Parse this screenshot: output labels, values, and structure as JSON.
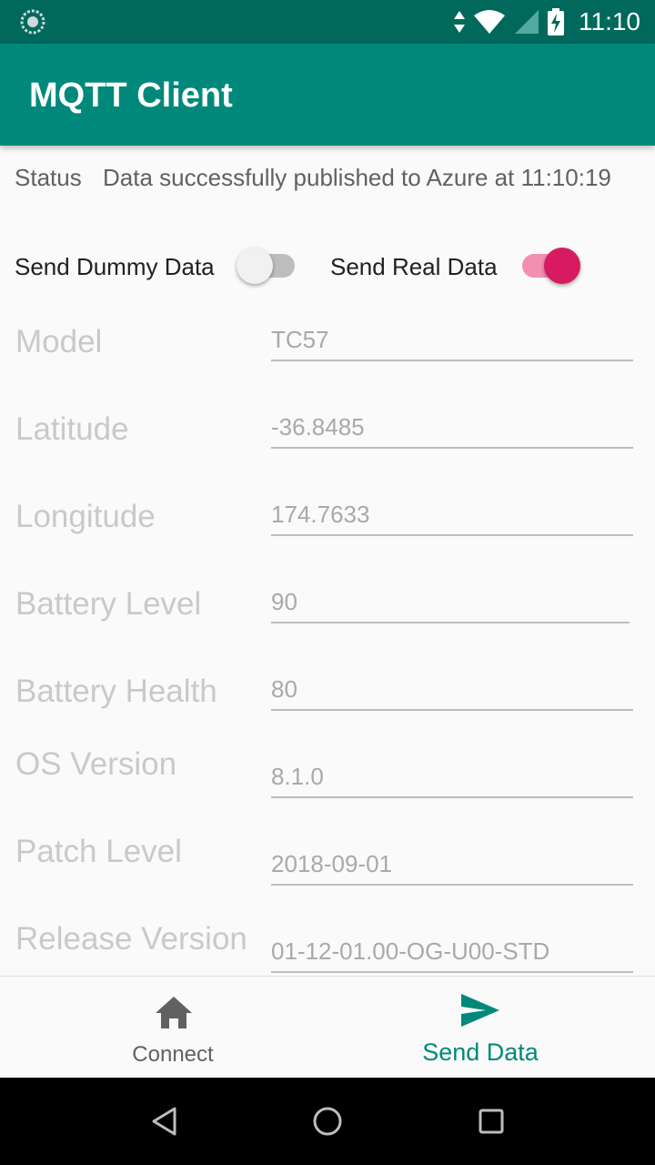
{
  "status_bar": {
    "time": "11:10",
    "icons": [
      "sync-icon",
      "data-arrows-icon",
      "wifi-icon",
      "signal-icon",
      "battery-charging-icon"
    ]
  },
  "app_bar": {
    "title": "MQTT Client"
  },
  "status": {
    "label": "Status",
    "message": "Data successfully published to Azure at 11:10:19"
  },
  "toggles": {
    "dummy": {
      "label": "Send Dummy Data",
      "checked": false
    },
    "real": {
      "label": "Send Real Data",
      "checked": true
    }
  },
  "fields": [
    {
      "label": "Model",
      "value": "TC57"
    },
    {
      "label": "Latitude",
      "value": "-36.8485"
    },
    {
      "label": "Longitude",
      "value": "174.7633"
    },
    {
      "label": "Battery Level",
      "value": "90"
    },
    {
      "label": "Battery Health",
      "value": "80"
    },
    {
      "label": "OS Version",
      "value": "8.1.0"
    },
    {
      "label": "Patch Level",
      "value": "2018-09-01"
    },
    {
      "label": "Release Version",
      "value": "01-12-01.00-OG-U00-STD"
    }
  ],
  "bottom_nav": {
    "items": [
      {
        "label": "Connect",
        "icon": "home-icon",
        "active": false
      },
      {
        "label": "Send Data",
        "icon": "send-icon",
        "active": true
      }
    ]
  },
  "colors": {
    "primary": "#00897b",
    "primary_dark": "#00695c",
    "accent": "#d81b60",
    "nav_active": "#00897b",
    "nav_inactive": "#616161"
  },
  "system_nav": [
    "back-icon",
    "home-circle-icon",
    "recents-icon"
  ]
}
